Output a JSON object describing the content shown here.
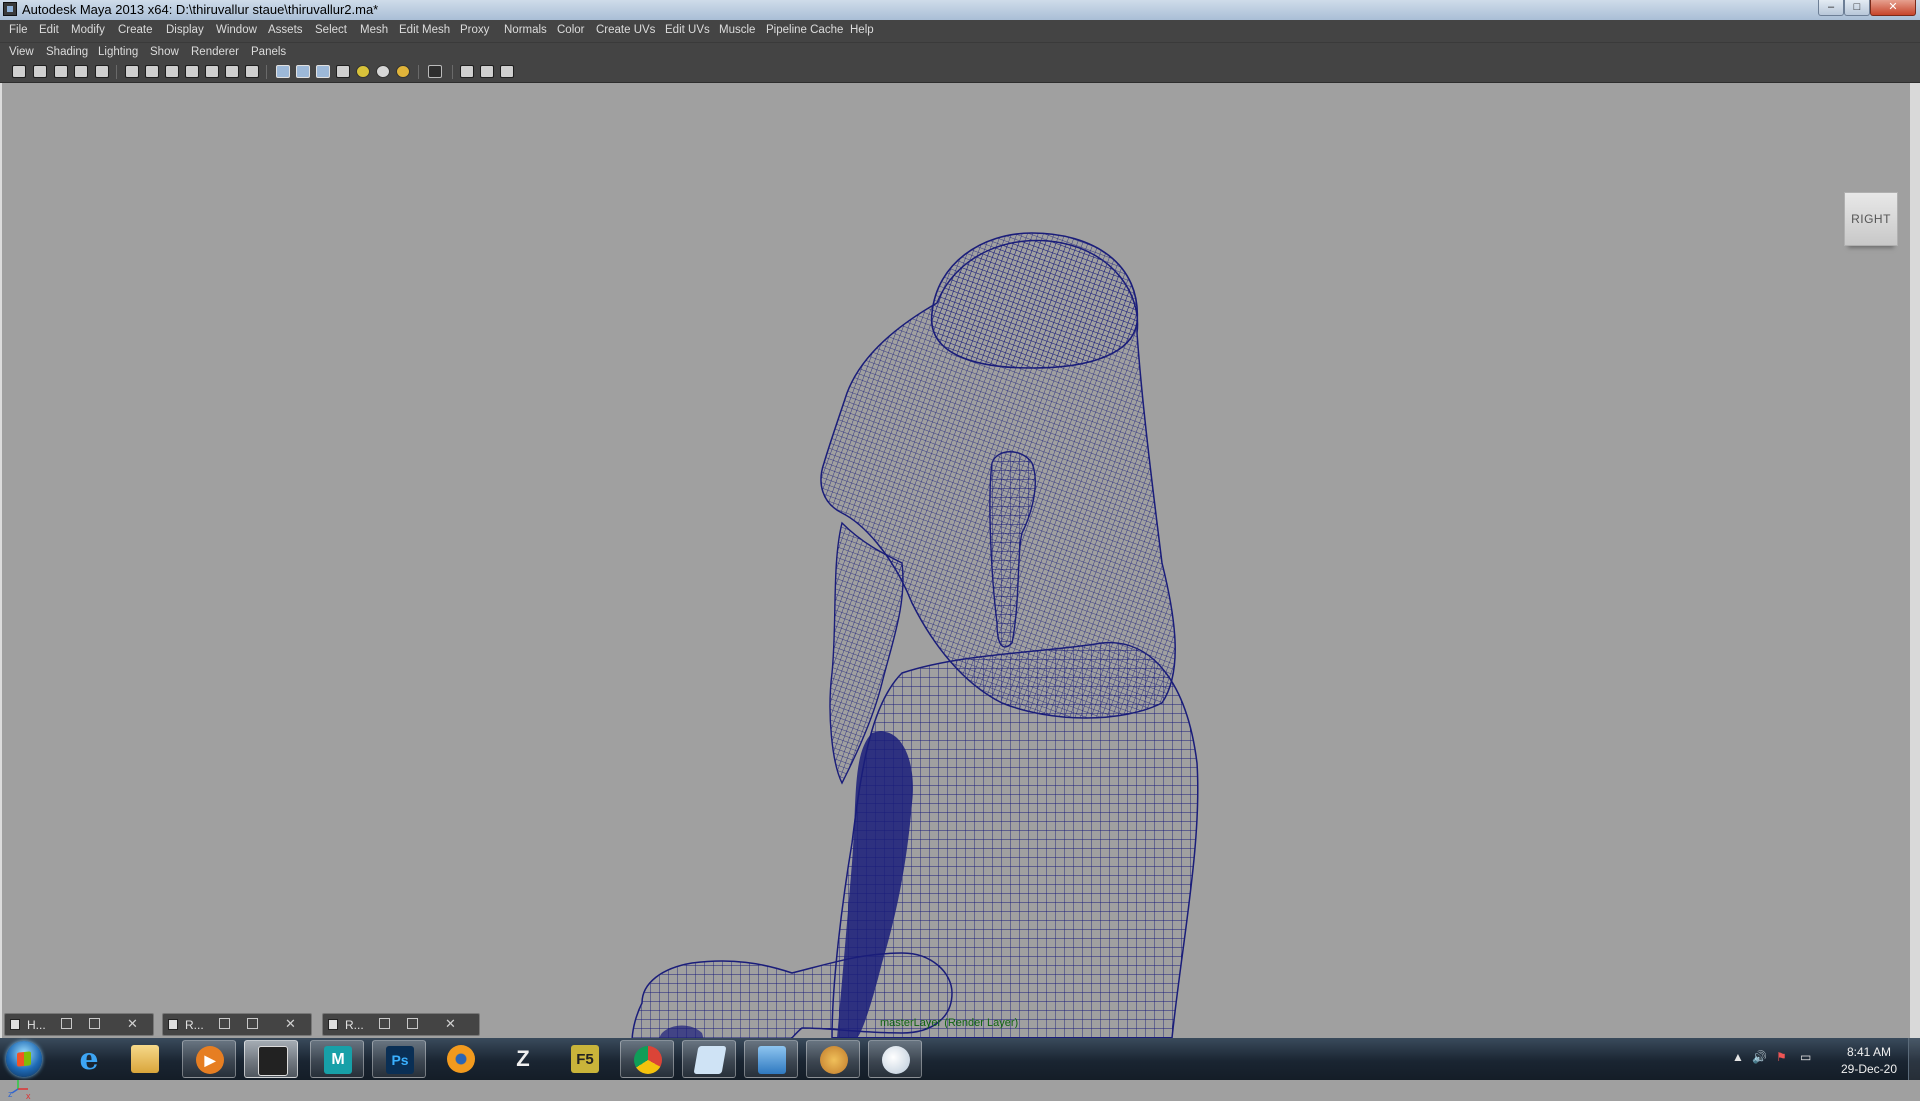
{
  "window": {
    "title": "Autodesk Maya 2013 x64: D:\\thiruvallur staue\\thiruvallur2.ma*",
    "controls": {
      "minimize": "–",
      "maximize": "□",
      "close": "✕"
    }
  },
  "menubar": [
    "File",
    "Edit",
    "Modify",
    "Create",
    "Display",
    "Window",
    "Assets",
    "Select",
    "Mesh",
    "Edit Mesh",
    "Proxy",
    "Normals",
    "Color",
    "Create UVs",
    "Edit UVs",
    "Muscle",
    "Pipeline Cache",
    "Help"
  ],
  "panel_menu": [
    "View",
    "Shading",
    "Lighting",
    "Show",
    "Renderer",
    "Panels"
  ],
  "viewport": {
    "view_cube_label": "RIGHT",
    "render_layer_label": "masterLayer (Render Layer)",
    "axis": {
      "z": "z",
      "y": "y",
      "x": "x"
    },
    "wireframe_color": "#1a1d7a",
    "background_color": "#a0a0a0"
  },
  "minimized_windows": [
    {
      "label": "H..."
    },
    {
      "label": "R..."
    },
    {
      "label": "R..."
    }
  ],
  "taskbar": {
    "apps": [
      {
        "name": "internet-explorer-icon",
        "glyph": "e"
      },
      {
        "name": "file-explorer-icon",
        "glyph": ""
      },
      {
        "name": "media-player-icon",
        "glyph": "▶"
      },
      {
        "name": "inkscape-icon",
        "glyph": ""
      },
      {
        "name": "maya-icon",
        "glyph": "M"
      },
      {
        "name": "photoshop-icon",
        "glyph": "Ps"
      },
      {
        "name": "blender-icon",
        "glyph": ""
      },
      {
        "name": "zbrush-icon",
        "glyph": "Z"
      },
      {
        "name": "f5-icon",
        "glyph": "F5"
      },
      {
        "name": "chrome-icon",
        "glyph": ""
      },
      {
        "name": "notepad-icon",
        "glyph": ""
      },
      {
        "name": "photo-viewer-icon",
        "glyph": ""
      },
      {
        "name": "paint-icon",
        "glyph": ""
      },
      {
        "name": "paint-brush-icon",
        "glyph": ""
      }
    ],
    "clock": {
      "time": "8:41 AM",
      "date": "29-Dec-20"
    }
  }
}
